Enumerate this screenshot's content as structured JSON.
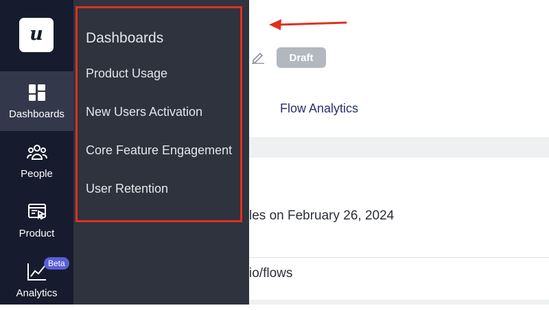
{
  "logo": {
    "letter": "u"
  },
  "rail": {
    "items": [
      {
        "label": "Dashboards",
        "icon": "dashboards-grid-icon",
        "active": true
      },
      {
        "label": "People",
        "icon": "people-icon",
        "active": false
      },
      {
        "label": "Product",
        "icon": "product-window-icon",
        "active": false
      },
      {
        "label": "Analytics",
        "icon": "analytics-chart-icon",
        "active": false,
        "badge": "Beta"
      }
    ]
  },
  "flyout": {
    "title": "Dashboards",
    "items": [
      {
        "label": "Product Usage"
      },
      {
        "label": "New Users Activation"
      },
      {
        "label": "Core Feature Engagement"
      },
      {
        "label": "User Retention"
      }
    ],
    "highlight_color": "#e0301e"
  },
  "main": {
    "status_badge": "Draft",
    "tab": "Flow Analytics",
    "partial_text_1": "les on February 26, 2024",
    "partial_text_2": "io/flows"
  },
  "colors": {
    "rail_bg": "#161c2d",
    "rail_active_bg": "#33394a",
    "flyout_bg": "#2e333e",
    "annotation_red": "#e0301e",
    "beta_badge": "#5b5fd6",
    "draft_badge": "#b3b8bf",
    "tab_text": "#2a2f6b"
  }
}
